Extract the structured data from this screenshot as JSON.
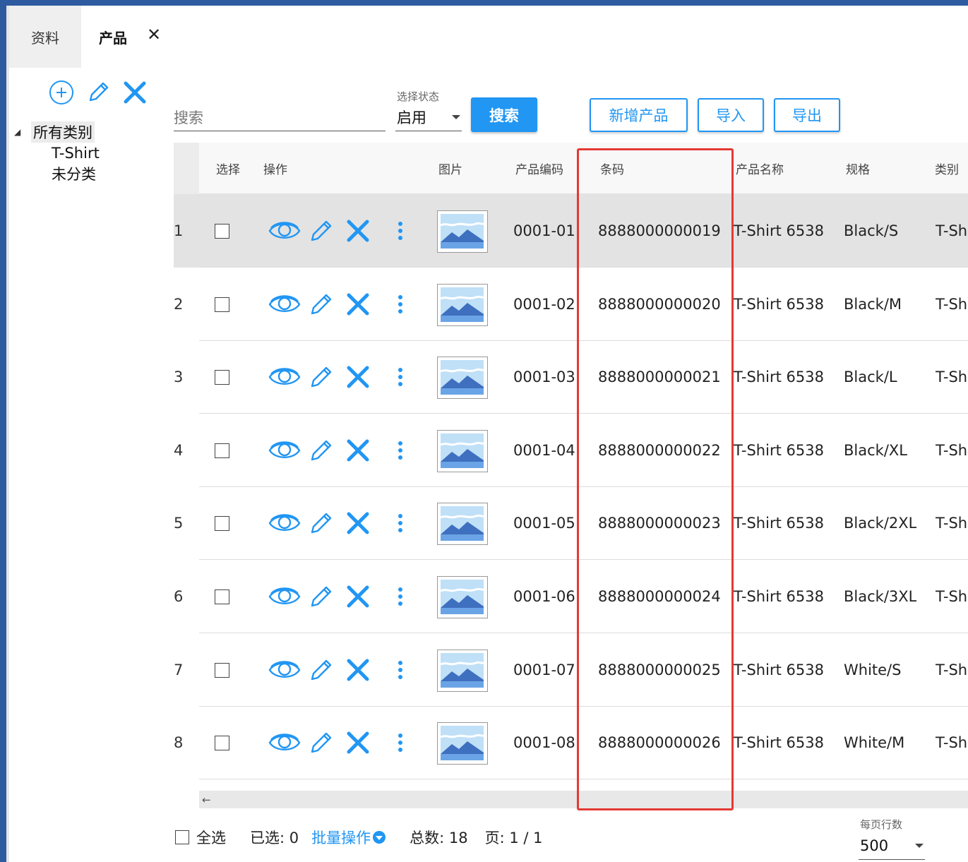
{
  "tabs": [
    {
      "label": "资料",
      "active": false
    },
    {
      "label": "产品",
      "active": true,
      "close": "✕"
    }
  ],
  "categories": {
    "root": "所有类别",
    "children": [
      "T-Shirt",
      "未分类"
    ]
  },
  "search": {
    "placeholder": "搜索",
    "status_caption": "选择状态",
    "status_value": "启用",
    "search_button": "搜索"
  },
  "toolbar": {
    "add_label": "新增产品",
    "import_label": "导入",
    "export_label": "导出"
  },
  "columns": [
    "选择",
    "操作",
    "图片",
    "产品编码",
    "条码",
    "产品名称",
    "规格",
    "类别"
  ],
  "rows": [
    {
      "num": "1",
      "code": "0001-01",
      "barcode": "8888000000019",
      "name": "T-Shirt 6538",
      "spec": "Black/S",
      "category": "T-Sh"
    },
    {
      "num": "2",
      "code": "0001-02",
      "barcode": "8888000000020",
      "name": "T-Shirt 6538",
      "spec": "Black/M",
      "category": "T-Sh"
    },
    {
      "num": "3",
      "code": "0001-03",
      "barcode": "8888000000021",
      "name": "T-Shirt 6538",
      "spec": "Black/L",
      "category": "T-Sh"
    },
    {
      "num": "4",
      "code": "0001-04",
      "barcode": "8888000000022",
      "name": "T-Shirt 6538",
      "spec": "Black/XL",
      "category": "T-Sh"
    },
    {
      "num": "5",
      "code": "0001-05",
      "barcode": "8888000000023",
      "name": "T-Shirt 6538",
      "spec": "Black/2XL",
      "category": "T-Sh"
    },
    {
      "num": "6",
      "code": "0001-06",
      "barcode": "8888000000024",
      "name": "T-Shirt 6538",
      "spec": "Black/3XL",
      "category": "T-Sh"
    },
    {
      "num": "7",
      "code": "0001-07",
      "barcode": "8888000000025",
      "name": "T-Shirt 6538",
      "spec": "White/S",
      "category": "T-Sh"
    },
    {
      "num": "8",
      "code": "0001-08",
      "barcode": "8888000000026",
      "name": "T-Shirt 6538",
      "spec": "White/M",
      "category": "T-Sh"
    }
  ],
  "scroll_left": "←",
  "footer": {
    "select_all": "全选",
    "selected": "已选: 0",
    "bulk": "批量操作",
    "total": "总数: 18",
    "page": "页: 1 / 1",
    "per_page_caption": "每页行数",
    "per_page_value": "500"
  },
  "colors": {
    "accent": "#2196f3",
    "highlight": "#e53935",
    "frame": "#2e5aa0"
  },
  "icons": [
    "add-circle-icon",
    "pencil-icon",
    "close-icon",
    "eye-icon",
    "more-vertical-icon",
    "image-placeholder-icon",
    "dropdown-caret-icon"
  ]
}
